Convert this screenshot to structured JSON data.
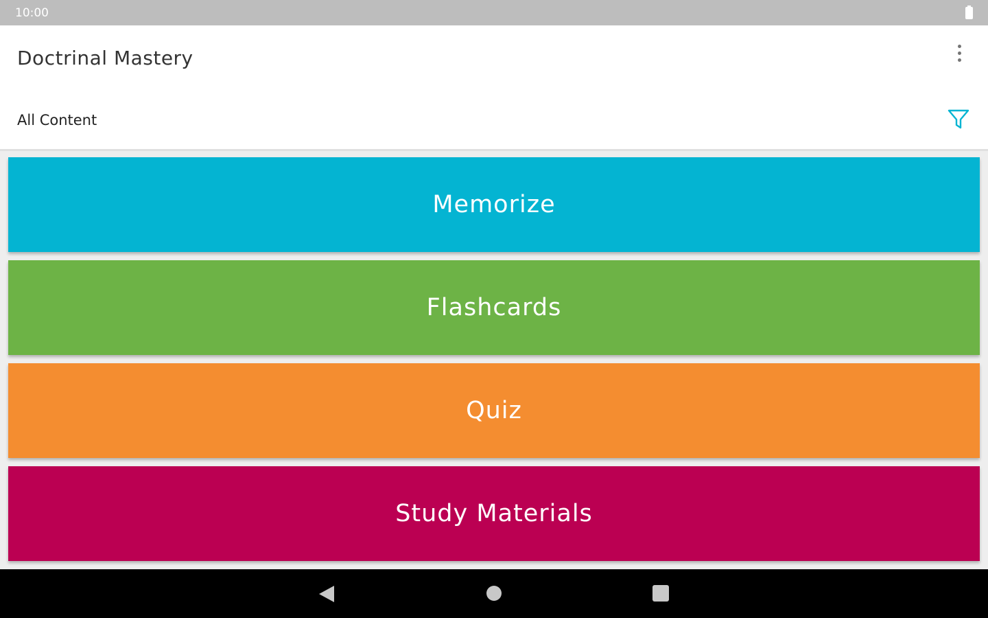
{
  "status_bar": {
    "time": "10:00"
  },
  "app_bar": {
    "title": "Doctrinal Mastery",
    "filter_label": "All Content"
  },
  "menu": [
    {
      "label": "Memorize",
      "color": "#04b4d2"
    },
    {
      "label": "Flashcards",
      "color": "#6db346"
    },
    {
      "label": "Quiz",
      "color": "#f48d30"
    },
    {
      "label": "Study Materials",
      "color": "#bb0052"
    }
  ],
  "icons": {
    "overflow": "more-vertical-icon",
    "filter": "filter-icon",
    "battery": "battery-icon",
    "back": "back-icon",
    "home": "home-icon",
    "recents": "recents-icon"
  },
  "colors": {
    "accent": "#04b4d2"
  }
}
